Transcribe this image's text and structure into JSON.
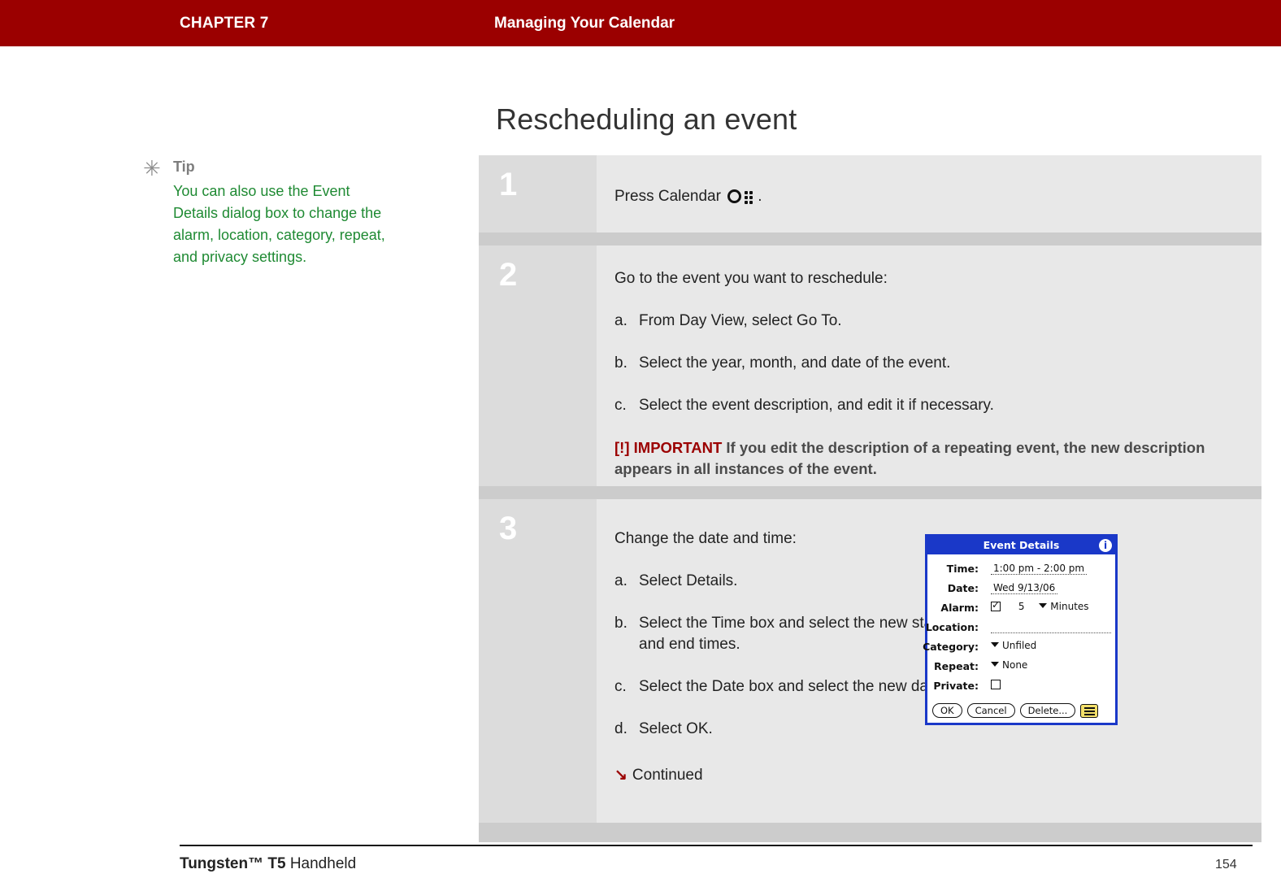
{
  "header": {
    "chapter": "CHAPTER 7",
    "title": "Managing Your Calendar"
  },
  "page_title": "Rescheduling an event",
  "tip": {
    "icon": "asterisk-icon",
    "label": "Tip",
    "body": "You can also use the Event Details dialog box to change the alarm, location, category, repeat, and privacy settings."
  },
  "steps": [
    {
      "number": "1",
      "text_before": "Press Calendar",
      "icon": "calendar-hardware-button-icon",
      "text_after": "."
    },
    {
      "number": "2",
      "intro": "Go to the event you want to reschedule:",
      "substeps": [
        {
          "marker": "a.",
          "text": "From Day View, select Go To."
        },
        {
          "marker": "b.",
          "text": "Select the year, month, and date of the event."
        },
        {
          "marker": "c.",
          "text": "Select the event description, and edit it if necessary."
        }
      ],
      "important": {
        "bracket_open": "[",
        "bang": "!",
        "bracket_close": "]",
        "word": "IMPORTANT",
        "text": "If you edit the description of a repeating event, the new description appears in all instances of the event."
      }
    },
    {
      "number": "3",
      "intro": "Change the date and time:",
      "substeps": [
        {
          "marker": "a.",
          "text": "Select Details."
        },
        {
          "marker": "b.",
          "text": "Select the Time box and select the new start and end times."
        },
        {
          "marker": "c.",
          "text": "Select the Date box and select the new date."
        },
        {
          "marker": "d.",
          "text": "Select OK."
        }
      ],
      "continued": "Continued",
      "continued_arrow": "↘"
    }
  ],
  "dialog": {
    "title": "Event Details",
    "info_icon": "i",
    "rows": [
      {
        "label": "Time:",
        "value": "1:00 pm - 2:00 pm"
      },
      {
        "label": "Date:",
        "value": "Wed 9/13/06"
      },
      {
        "label": "Alarm:",
        "value": "5",
        "unit": "Minutes"
      },
      {
        "label": "Location:",
        "value": ""
      },
      {
        "label": "Category:",
        "value": "Unfiled"
      },
      {
        "label": "Repeat:",
        "value": "None"
      },
      {
        "label": "Private:",
        "value": ""
      }
    ],
    "buttons": [
      "OK",
      "Cancel",
      "Delete..."
    ],
    "note_button": "note-icon"
  },
  "footer": {
    "product_bold": "Tungsten™ T5",
    "product_rest": " Handheld",
    "page_number": "154"
  }
}
